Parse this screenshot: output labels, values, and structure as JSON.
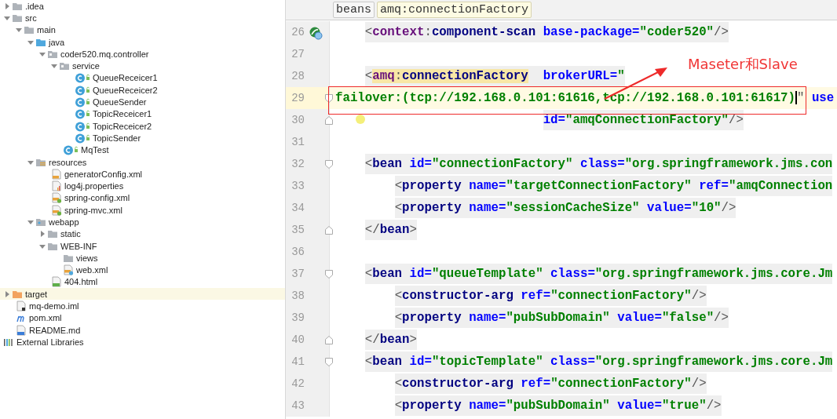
{
  "project_tree": [
    {
      "label": ".idea",
      "kind": "folder",
      "expanded": false
    },
    {
      "label": "src",
      "kind": "folder",
      "expanded": true,
      "children": [
        {
          "label": "main",
          "kind": "folder",
          "expanded": true,
          "children": [
            {
              "label": "java",
              "kind": "source-folder",
              "expanded": true,
              "children": [
                {
                  "label": "coder520.mq.controller",
                  "kind": "package",
                  "expanded": true,
                  "children": [
                    {
                      "label": "service",
                      "kind": "package",
                      "expanded": true,
                      "children": [
                        {
                          "label": "QueueReceicer1",
                          "kind": "class"
                        },
                        {
                          "label": "QueueReceicer2",
                          "kind": "class"
                        },
                        {
                          "label": "QueueSender",
                          "kind": "class"
                        },
                        {
                          "label": "TopicReceicer1",
                          "kind": "class"
                        },
                        {
                          "label": "TopicReceicer2",
                          "kind": "class"
                        },
                        {
                          "label": "TopicSender",
                          "kind": "class"
                        }
                      ]
                    },
                    {
                      "label": "MqTest",
                      "kind": "class"
                    }
                  ]
                }
              ]
            },
            {
              "label": "resources",
              "kind": "resources-folder",
              "expanded": true,
              "children": [
                {
                  "label": "generatorConfig.xml",
                  "kind": "xml"
                },
                {
                  "label": "log4j.properties",
                  "kind": "properties"
                },
                {
                  "label": "spring-config.xml",
                  "kind": "spring-xml"
                },
                {
                  "label": "spring-mvc.xml",
                  "kind": "spring-xml"
                }
              ]
            },
            {
              "label": "webapp",
              "kind": "web-folder",
              "expanded": true,
              "children": [
                {
                  "label": "static",
                  "kind": "folder",
                  "expanded": false
                },
                {
                  "label": "WEB-INF",
                  "kind": "folder",
                  "expanded": true,
                  "children": [
                    {
                      "label": "views",
                      "kind": "folder"
                    },
                    {
                      "label": "web.xml",
                      "kind": "web-xml"
                    }
                  ]
                },
                {
                  "label": "404.html",
                  "kind": "html"
                }
              ]
            }
          ]
        }
      ]
    },
    {
      "label": "target",
      "kind": "excluded-folder",
      "expanded": false
    },
    {
      "label": "mq-demo.iml",
      "kind": "module"
    },
    {
      "label": "pom.xml",
      "kind": "maven"
    },
    {
      "label": "README.md",
      "kind": "markdown"
    },
    {
      "label": "External Libraries",
      "kind": "libraries"
    }
  ],
  "breadcrumbs": [
    {
      "label": "beans",
      "selected": false
    },
    {
      "label": "amq:connectionFactory",
      "selected": true
    }
  ],
  "code_lines": [
    {
      "number": "26",
      "current": false,
      "marks": [
        {
          "kind": "bean"
        }
      ],
      "segments": [
        {
          "kind": "punct",
          "text": "    <"
        },
        {
          "kind": "ns",
          "text": "context"
        },
        {
          "kind": "punct",
          "text": ":"
        },
        {
          "kind": "tag",
          "text": "component-scan"
        },
        {
          "kind": "attr",
          "text": " base-package="
        },
        {
          "kind": "value",
          "text": "\"coder520\""
        },
        {
          "kind": "punct",
          "text": "/>"
        }
      ]
    },
    {
      "number": "27",
      "current": false
    },
    {
      "number": "28",
      "current": false,
      "segments": [
        {
          "kind": "punct",
          "text": "    <"
        },
        {
          "kind": "ns-match",
          "text": "amq"
        },
        {
          "kind": "punct-match",
          "text": ":"
        },
        {
          "kind": "tag-match",
          "text": "connectionFactory"
        },
        {
          "kind": "attr",
          "text": "  brokerURL="
        },
        {
          "kind": "value",
          "text": "\""
        }
      ]
    },
    {
      "number": "29",
      "current": true,
      "marks": [
        {
          "kind": "fold-start"
        }
      ],
      "segments": [
        {
          "kind": "value",
          "text": "failover:(tcp://192.168.0.101:61616,tcp://192.168.0.101:61617)"
        },
        {
          "kind": "caret"
        },
        {
          "kind": "punct",
          "text": "\""
        },
        {
          "kind": "attr",
          "text": " use"
        }
      ]
    },
    {
      "number": "30",
      "current": false,
      "marks": [
        {
          "kind": "fold-end"
        },
        {
          "kind": "bulb"
        }
      ],
      "segments": [
        {
          "kind": "attr",
          "text": "                            id="
        },
        {
          "kind": "value",
          "text": "\"amqConnectionFactory\""
        },
        {
          "kind": "punct",
          "text": "/>"
        }
      ]
    },
    {
      "number": "31",
      "current": false
    },
    {
      "number": "32",
      "current": false,
      "marks": [
        {
          "kind": "fold-start"
        }
      ],
      "segments": [
        {
          "kind": "punct",
          "text": "    <"
        },
        {
          "kind": "tag",
          "text": "bean"
        },
        {
          "kind": "attr",
          "text": " id="
        },
        {
          "kind": "value",
          "text": "\"connectionFactory\""
        },
        {
          "kind": "attr",
          "text": " class="
        },
        {
          "kind": "value",
          "text": "\"org.springframework.jms.con"
        }
      ]
    },
    {
      "number": "33",
      "current": false,
      "segments": [
        {
          "kind": "punct",
          "text": "        <"
        },
        {
          "kind": "tag",
          "text": "property"
        },
        {
          "kind": "attr",
          "text": " name="
        },
        {
          "kind": "value",
          "text": "\"targetConnectionFactory\""
        },
        {
          "kind": "attr",
          "text": " ref="
        },
        {
          "kind": "value",
          "text": "\"amqConnection"
        }
      ]
    },
    {
      "number": "34",
      "current": false,
      "segments": [
        {
          "kind": "punct",
          "text": "        <"
        },
        {
          "kind": "tag",
          "text": "property"
        },
        {
          "kind": "attr",
          "text": " name="
        },
        {
          "kind": "value",
          "text": "\"sessionCacheSize\""
        },
        {
          "kind": "attr",
          "text": " value="
        },
        {
          "kind": "value",
          "text": "\"10\""
        },
        {
          "kind": "punct",
          "text": "/>"
        }
      ]
    },
    {
      "number": "35",
      "current": false,
      "marks": [
        {
          "kind": "fold-end"
        }
      ],
      "segments": [
        {
          "kind": "punct",
          "text": "    </"
        },
        {
          "kind": "tag",
          "text": "bean"
        },
        {
          "kind": "punct",
          "text": ">"
        }
      ]
    },
    {
      "number": "36",
      "current": false
    },
    {
      "number": "37",
      "current": false,
      "marks": [
        {
          "kind": "fold-start"
        }
      ],
      "segments": [
        {
          "kind": "punct",
          "text": "    <"
        },
        {
          "kind": "tag",
          "text": "bean"
        },
        {
          "kind": "attr",
          "text": " id="
        },
        {
          "kind": "value",
          "text": "\"queueTemplate\""
        },
        {
          "kind": "attr",
          "text": " class="
        },
        {
          "kind": "value",
          "text": "\"org.springframework.jms.core.Jm"
        }
      ]
    },
    {
      "number": "38",
      "current": false,
      "segments": [
        {
          "kind": "punct",
          "text": "        <"
        },
        {
          "kind": "tag",
          "text": "constructor-arg"
        },
        {
          "kind": "attr",
          "text": " ref="
        },
        {
          "kind": "value",
          "text": "\"connectionFactory\""
        },
        {
          "kind": "punct",
          "text": "/>"
        }
      ]
    },
    {
      "number": "39",
      "current": false,
      "segments": [
        {
          "kind": "punct",
          "text": "        <"
        },
        {
          "kind": "tag",
          "text": "property"
        },
        {
          "kind": "attr",
          "text": " name="
        },
        {
          "kind": "value",
          "text": "\"pubSubDomain\""
        },
        {
          "kind": "attr",
          "text": " value="
        },
        {
          "kind": "value",
          "text": "\"false\""
        },
        {
          "kind": "punct",
          "text": "/>"
        }
      ]
    },
    {
      "number": "40",
      "current": false,
      "marks": [
        {
          "kind": "fold-end"
        }
      ],
      "segments": [
        {
          "kind": "punct",
          "text": "    </"
        },
        {
          "kind": "tag",
          "text": "bean"
        },
        {
          "kind": "punct",
          "text": ">"
        }
      ]
    },
    {
      "number": "41",
      "current": false,
      "marks": [
        {
          "kind": "fold-start"
        }
      ],
      "segments": [
        {
          "kind": "punct",
          "text": "    <"
        },
        {
          "kind": "tag",
          "text": "bean"
        },
        {
          "kind": "attr",
          "text": " id="
        },
        {
          "kind": "value",
          "text": "\"topicTemplate\""
        },
        {
          "kind": "attr",
          "text": " class="
        },
        {
          "kind": "value",
          "text": "\"org.springframework.jms.core.Jm"
        }
      ]
    },
    {
      "number": "42",
      "current": false,
      "segments": [
        {
          "kind": "punct",
          "text": "        <"
        },
        {
          "kind": "tag",
          "text": "constructor-arg"
        },
        {
          "kind": "attr",
          "text": " ref="
        },
        {
          "kind": "value",
          "text": "\"connectionFactory\""
        },
        {
          "kind": "punct",
          "text": "/>"
        }
      ]
    },
    {
      "number": "43",
      "current": false,
      "segments": [
        {
          "kind": "punct",
          "text": "        <"
        },
        {
          "kind": "tag",
          "text": "property"
        },
        {
          "kind": "attr",
          "text": " name="
        },
        {
          "kind": "value",
          "text": "\"pubSubDomain\""
        },
        {
          "kind": "attr",
          "text": " value="
        },
        {
          "kind": "value",
          "text": "\"true\""
        },
        {
          "kind": "punct",
          "text": "/>"
        }
      ]
    }
  ],
  "annotation": {
    "text": "Maseter和Slave"
  }
}
